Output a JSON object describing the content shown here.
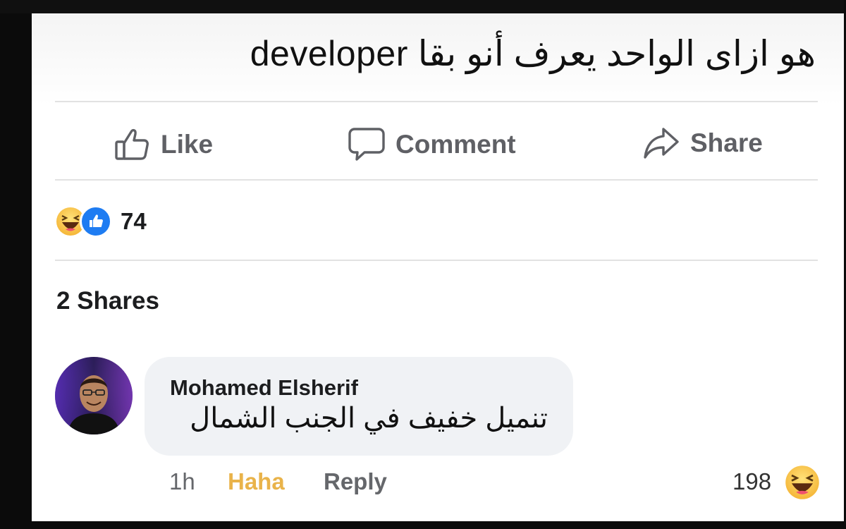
{
  "post": {
    "text": "هو ازاى الواحد يعرف أنو بقا developer"
  },
  "actions": {
    "like_label": "Like",
    "comment_label": "Comment",
    "share_label": "Share"
  },
  "reactions": {
    "count": "74",
    "types": [
      "haha",
      "like"
    ]
  },
  "shares_label": "2 Shares",
  "comment": {
    "author": "Mohamed Elsherif",
    "text": "تنميل خفيف في الجنب الشمال",
    "time": "1h",
    "reaction_label": "Haha",
    "reply_label": "Reply",
    "reaction_count": "198"
  },
  "colors": {
    "action_gray": "#5f6065",
    "like_blue": "#1e7cf2",
    "haha_yellow": "#e9b34a",
    "bubble_bg": "#f0f2f5"
  }
}
